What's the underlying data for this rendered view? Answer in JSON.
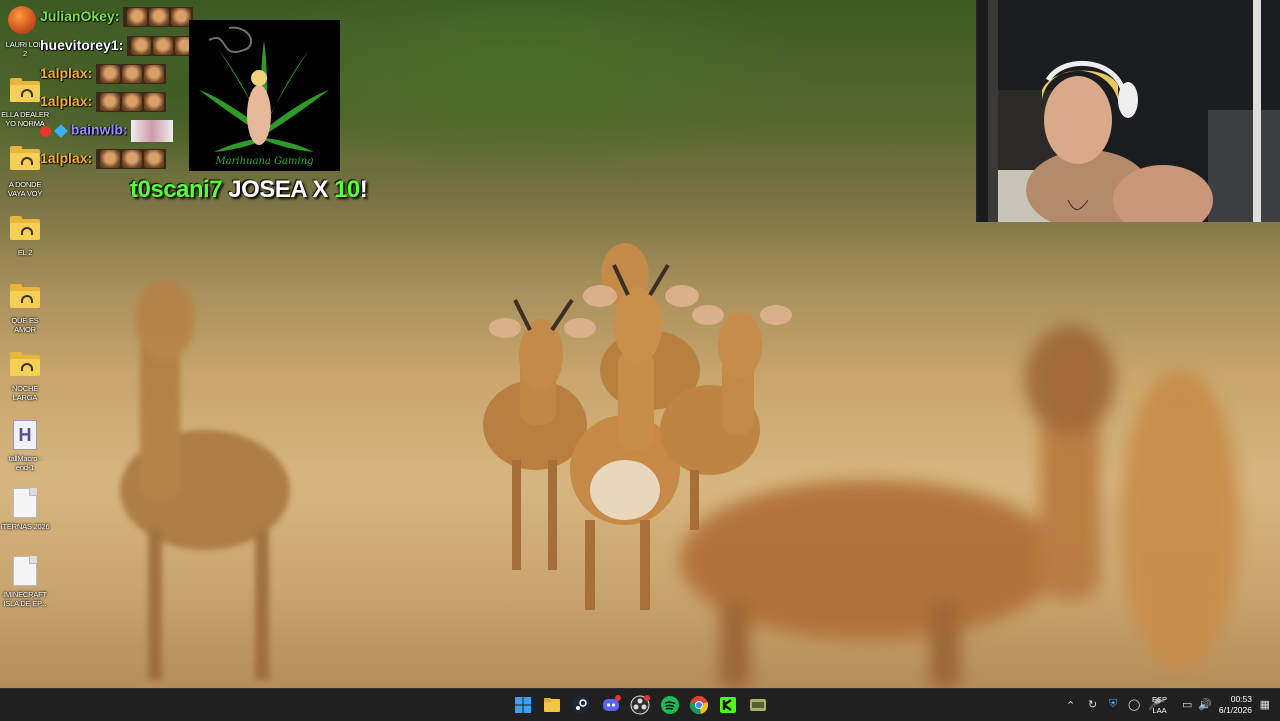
{
  "desktop": {
    "icons": [
      {
        "label": "LAURI LOLI\n2",
        "kind": "app"
      },
      {
        "label": "ELLA DEALER\nYO NORMA",
        "kind": "folder"
      },
      {
        "label": "A DONDE\nVAYA VOY",
        "kind": "folder"
      },
      {
        "label": "EL 2",
        "kind": "folder"
      },
      {
        "label": "QUE ES\nAMOR",
        "kind": "folder"
      },
      {
        "label": "NOCHE\nLARGA",
        "kind": "folder"
      },
      {
        "label": "tallMacro -\nend-1",
        "kind": "h-file"
      },
      {
        "label": "ITERNAS 2026",
        "kind": "file"
      },
      {
        "label": "IMINECRAFT\nISLA DE EP...",
        "kind": "file"
      }
    ]
  },
  "chat": {
    "messages": [
      {
        "user": "JulianOkey:",
        "color": "#7fe04a"
      },
      {
        "user": "huevitorey1:",
        "color": "#ffffff"
      },
      {
        "user": "1alplax:",
        "color": "#f0b03a"
      },
      {
        "user": "1alplax:",
        "color": "#f0b03a"
      },
      {
        "user": "bainwlb:",
        "color": "#9a8cff"
      },
      {
        "user": "1alplax:",
        "color": "#f0b03a"
      }
    ]
  },
  "alert": {
    "user": "t0scani7",
    "action": " JOSEA X ",
    "count": "10",
    "suffix": "!",
    "user_color": "#5aff3c",
    "count_color": "#5aff3c"
  },
  "promo": {
    "text": "Marihuana Gaming"
  },
  "taskbar": {
    "apps": [
      "windows-start-icon",
      "file-explorer-icon",
      "steam-icon",
      "discord-icon",
      "obs-icon",
      "spotify-icon",
      "chrome-icon",
      "kick-icon",
      "game-icon"
    ],
    "language_top": "ESP",
    "language_bottom": "LAA",
    "time": "00:53",
    "date": "6/1/2026"
  }
}
